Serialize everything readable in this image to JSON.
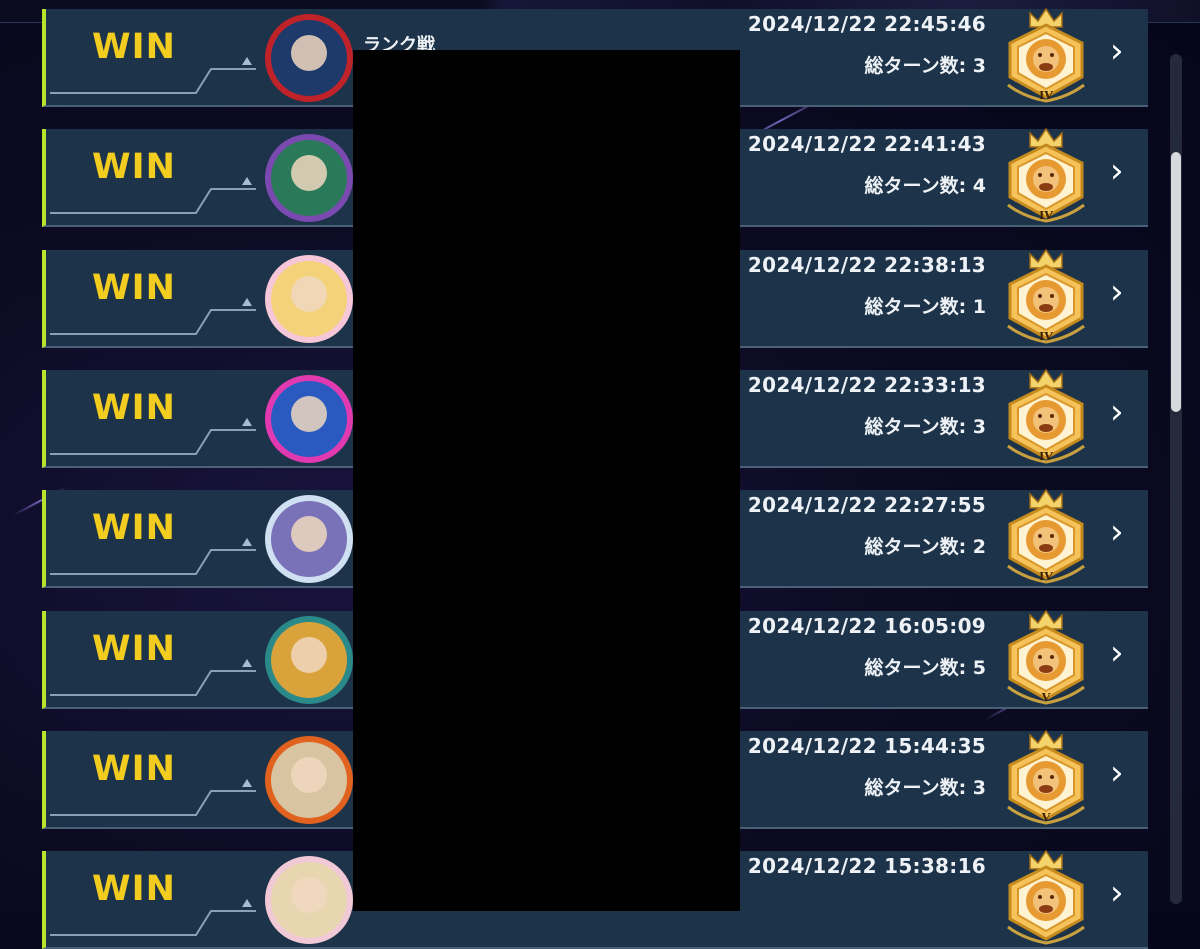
{
  "header": {
    "mode_title": "ランク戦"
  },
  "matches": [
    {
      "result": "WIN",
      "datetime": "2024/12/22 22:45:46",
      "turns": "総ターン数: 3",
      "rank": "IV",
      "avatar_colors": [
        "#c0222a",
        "#1e3a6a"
      ]
    },
    {
      "result": "WIN",
      "datetime": "2024/12/22 22:41:43",
      "turns": "総ターン数: 4",
      "rank": "IV",
      "avatar_colors": [
        "#7a4ab0",
        "#2a7a5a"
      ]
    },
    {
      "result": "WIN",
      "datetime": "2024/12/22 22:38:13",
      "turns": "総ターン数: 1",
      "rank": "IV",
      "avatar_colors": [
        "#f6c7d8",
        "#f3d27a"
      ]
    },
    {
      "result": "WIN",
      "datetime": "2024/12/22 22:33:13",
      "turns": "総ターン数: 3",
      "rank": "IV",
      "avatar_colors": [
        "#e13ab0",
        "#2a5ac0"
      ]
    },
    {
      "result": "WIN",
      "datetime": "2024/12/22 22:27:55",
      "turns": "総ターン数: 2",
      "rank": "IV",
      "avatar_colors": [
        "#cfe0f2",
        "#7a72b8"
      ]
    },
    {
      "result": "WIN",
      "datetime": "2024/12/22 16:05:09",
      "turns": "総ターン数: 5",
      "rank": "V",
      "avatar_colors": [
        "#2a8a8a",
        "#d9a23a"
      ]
    },
    {
      "result": "WIN",
      "datetime": "2024/12/22 15:44:35",
      "turns": "総ターン数: 3",
      "rank": "V",
      "avatar_colors": [
        "#e0621e",
        "#d8c4a0"
      ]
    },
    {
      "result": "WIN",
      "datetime": "2024/12/22 15:38:16",
      "turns": "",
      "rank": "",
      "avatar_colors": [
        "#f1c9d6",
        "#e8d6b0"
      ]
    }
  ],
  "icons": {
    "chevron": "chevron-right-icon",
    "badge": "lion-rank-badge-icon",
    "deco": "arrow-line-icon"
  },
  "colors": {
    "win": "#f2cc1e",
    "accent_bar": "#b8e42c",
    "row_bg": "#1d3349",
    "badge_gold": "#e2a12a"
  }
}
